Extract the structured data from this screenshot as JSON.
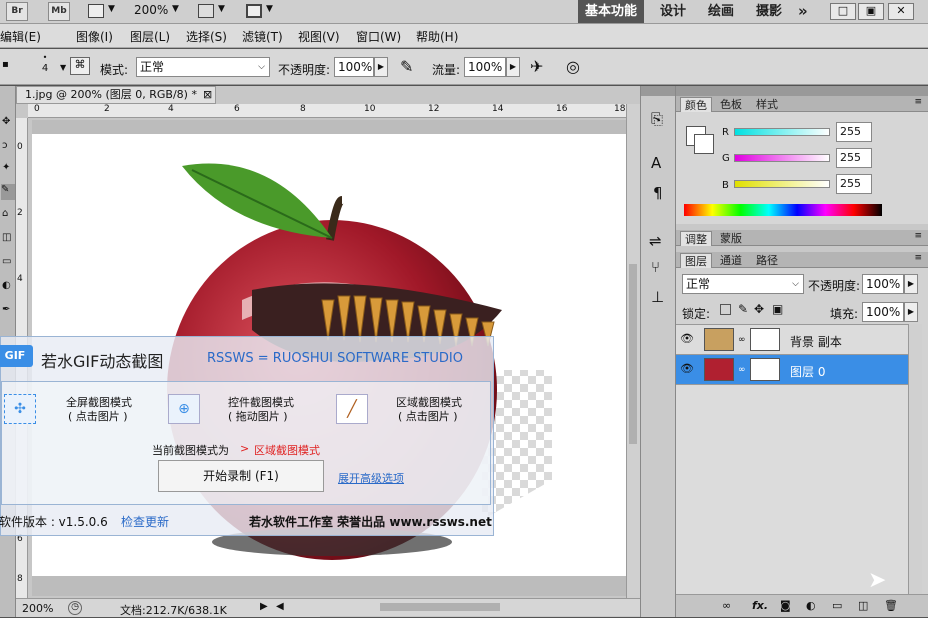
{
  "topbar": {
    "br_label": "Br",
    "mb_label": "Mb",
    "zoom": "200%",
    "workspaces": [
      "基本功能",
      "设计",
      "绘画",
      "摄影"
    ],
    "more": "»",
    "win_min": "□",
    "win_max": "▣",
    "win_close": "✕"
  },
  "menus": [
    "编辑(E)",
    "图像(I)",
    "图层(L)",
    "选择(S)",
    "滤镜(T)",
    "视图(V)",
    "窗口(W)",
    "帮助(H)"
  ],
  "options": {
    "brush_size": "4",
    "mode_label": "模式:",
    "mode_value": "正常",
    "opacity_label": "不透明度:",
    "opacity_value": "100%",
    "flow_label": "流量:",
    "flow_value": "100%"
  },
  "document": {
    "tab_title": "1.jpg @ 200% (图层 0, RGB/8) *",
    "tab_close": "⊠",
    "ruler_h": [
      "0",
      "2",
      "4",
      "6",
      "8",
      "10",
      "12",
      "14",
      "16",
      "18"
    ],
    "ruler_v": [
      "0",
      "2",
      "4",
      "6",
      "8"
    ],
    "status_zoom": "200%",
    "status_doc": "文档:212.7K/638.1K"
  },
  "color_panel": {
    "tabs": [
      "颜色",
      "色板",
      "样式"
    ],
    "channels": [
      {
        "label": "R",
        "value": "255",
        "gradient": "#00e0e0"
      },
      {
        "label": "G",
        "value": "255",
        "gradient": "#e000e0"
      },
      {
        "label": "B",
        "value": "255",
        "gradient": "#e0e000"
      }
    ]
  },
  "adjust_panel": {
    "tabs": [
      "调整",
      "蒙版"
    ]
  },
  "layers_panel": {
    "tabs": [
      "图层",
      "通道",
      "路径"
    ],
    "blend_mode": "正常",
    "opacity_label": "不透明度:",
    "opacity_value": "100%",
    "lock_label": "锁定:",
    "fill_label": "填充:",
    "fill_value": "100%",
    "layers": [
      {
        "name": "背景 副本",
        "selected": false
      },
      {
        "name": "图层 0",
        "selected": true
      }
    ],
    "footer_fx": "fx."
  },
  "overlay": {
    "logo": "GIF",
    "app_title": "若水GIF动态截图",
    "studio": "RSSWS = RUOSHUI SOFTWARE STUDIO",
    "modes": [
      {
        "label": "全屏截图模式",
        "hint": "( 点击图片 )"
      },
      {
        "label": "控件截图模式",
        "hint": "( 拖动图片 )"
      },
      {
        "label": "区域截图模式",
        "hint": "( 点击图片 )"
      }
    ],
    "current_label": "当前截图模式为",
    "current_arrow": ">",
    "current_value": "区域截图模式",
    "record_button": "开始录制 (F1)",
    "advanced_link": "展开高级选项",
    "version": "软件版本 : v1.5.0.6",
    "check_update": "检查更新",
    "credit": "若水软件工作室 荣誉出品 www.rssws.net"
  },
  "colors": {
    "accent": "#3a8ee6",
    "selected_layer": "#3a8ee6",
    "red_text": "#e02020"
  }
}
